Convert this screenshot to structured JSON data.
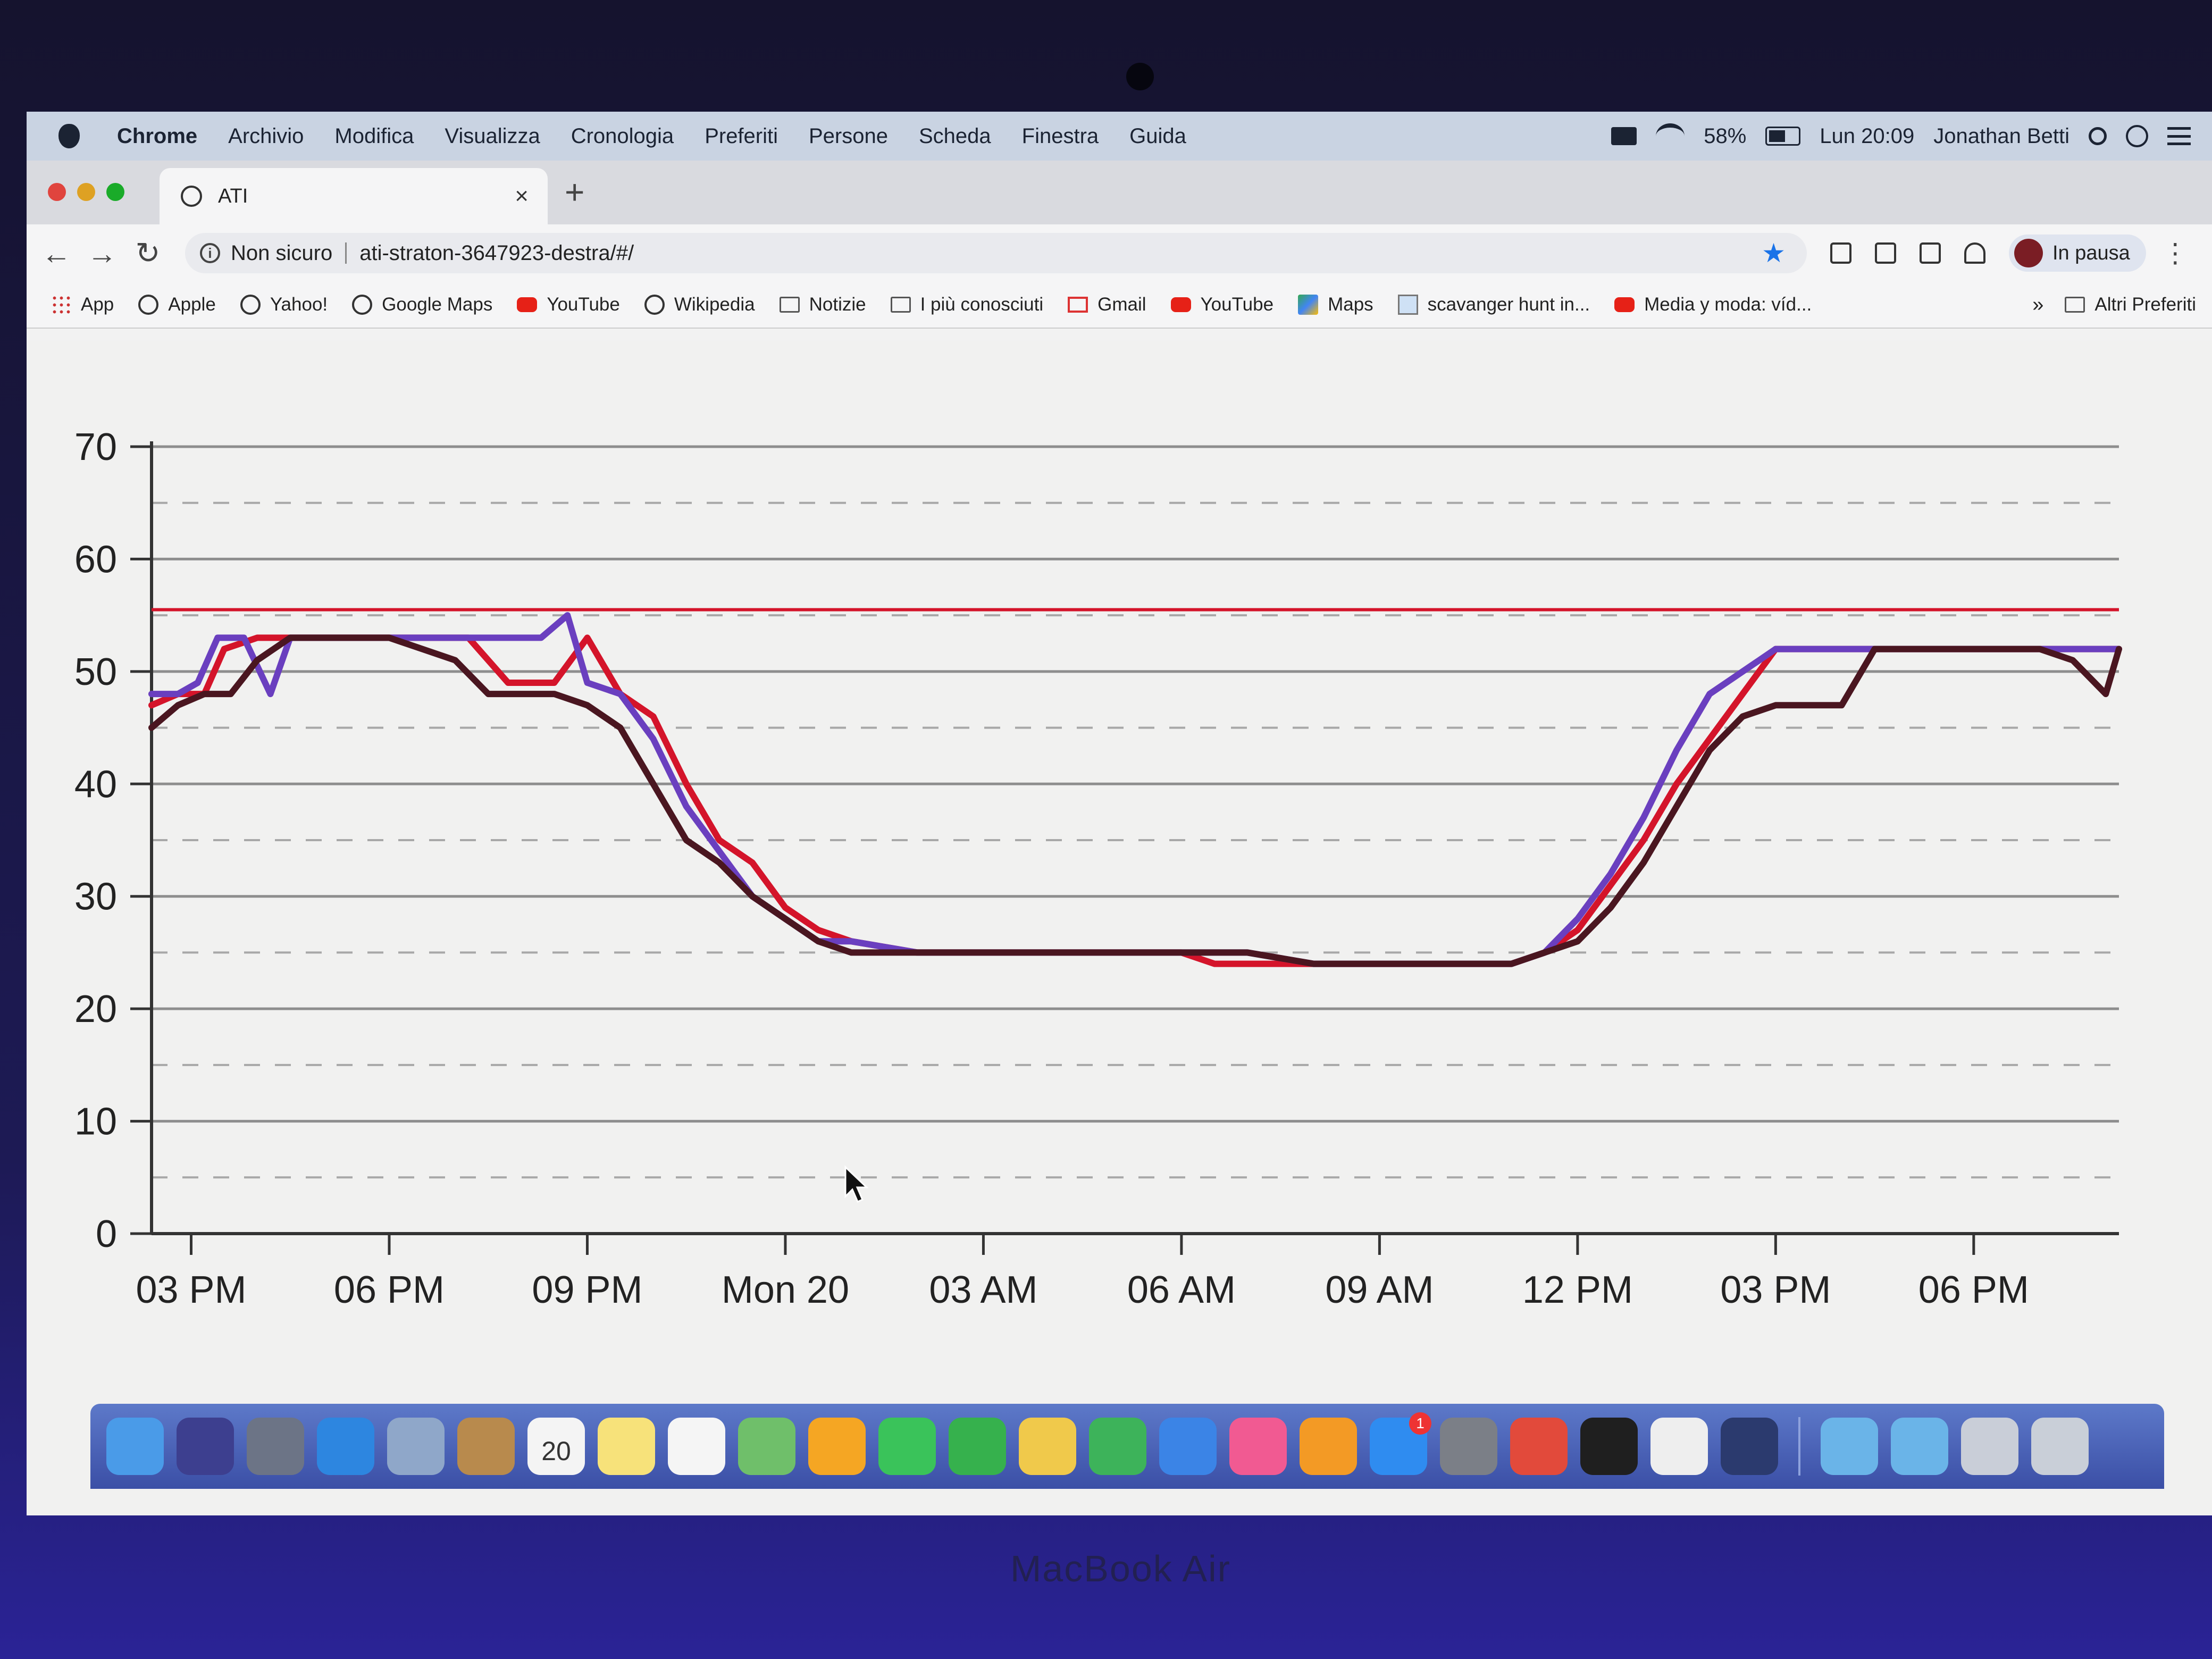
{
  "menubar": {
    "app_name": "Chrome",
    "items": [
      "Archivio",
      "Modifica",
      "Visualizza",
      "Cronologia",
      "Preferiti",
      "Persone",
      "Scheda",
      "Finestra",
      "Guida"
    ],
    "battery": "58%",
    "clock": "Lun 20:09",
    "user": "Jonathan Betti"
  },
  "tab": {
    "title": "ATI",
    "close": "×",
    "new_tab": "+"
  },
  "toolbar": {
    "security_label": "Non sicuro",
    "url": "ati-straton-3647923-destra/#/",
    "profile_label": "In pausa"
  },
  "bookmarks": {
    "items": [
      {
        "label": "App",
        "icon": "apps-grid-icon"
      },
      {
        "label": "Apple",
        "icon": "globe-icon"
      },
      {
        "label": "Yahoo!",
        "icon": "globe-icon"
      },
      {
        "label": "Google Maps",
        "icon": "globe-icon"
      },
      {
        "label": "YouTube",
        "icon": "youtube-icon"
      },
      {
        "label": "Wikipedia",
        "icon": "globe-icon"
      },
      {
        "label": "Notizie",
        "icon": "folder-icon"
      },
      {
        "label": "I più conosciuti",
        "icon": "folder-icon"
      },
      {
        "label": "Gmail",
        "icon": "gmail-icon"
      },
      {
        "label": "YouTube",
        "icon": "youtube-icon"
      },
      {
        "label": "Maps",
        "icon": "maps-icon"
      },
      {
        "label": "scavanger hunt in...",
        "icon": "document-icon"
      },
      {
        "label": "Media y moda: víd...",
        "icon": "youtube-icon"
      }
    ],
    "more": "»",
    "other": "Altri Preferiti"
  },
  "chart_data": {
    "type": "line",
    "ylim": [
      0,
      70
    ],
    "y_ticks": [
      "0",
      "10",
      "20",
      "30",
      "40",
      "50",
      "60",
      "70"
    ],
    "x_ticks": [
      "03 PM",
      "06 PM",
      "09 PM",
      "Mon 20",
      "03 AM",
      "06 AM",
      "09 AM",
      "12 PM",
      "03 PM",
      "06 PM"
    ],
    "x_tick_hours": [
      15,
      18,
      21,
      24,
      27,
      30,
      33,
      36,
      39,
      42
    ],
    "xlim_hours": [
      14.4,
      44.2
    ],
    "grid": true,
    "threshold": {
      "value": 55.5,
      "color": "#d4142a"
    },
    "series": [
      {
        "color": "#d4142a",
        "x": [
          14.4,
          14.8,
          15.2,
          15.5,
          16,
          16.5,
          17,
          17.5,
          18,
          18.5,
          19.2,
          19.8,
          20.5,
          21,
          21.5,
          22,
          22.5,
          23,
          23.5,
          24,
          24.5,
          25,
          26,
          28,
          30,
          30.5,
          31,
          32,
          33,
          34,
          35,
          35.5,
          36,
          36.5,
          37,
          37.5,
          38,
          38.5,
          39,
          39.5,
          40,
          41,
          42,
          43,
          44,
          44.2
        ],
        "y": [
          47,
          48,
          48,
          52,
          53,
          53,
          53,
          53,
          53,
          53,
          53,
          49,
          49,
          53,
          48,
          46,
          40,
          35,
          33,
          29,
          27,
          26,
          25,
          25,
          25,
          24,
          24,
          24,
          24,
          24,
          24,
          25,
          27,
          31,
          35,
          40,
          44,
          48,
          52,
          52,
          52,
          52,
          52,
          52,
          52,
          52
        ]
      },
      {
        "color": "#6a3fbf",
        "x": [
          14.4,
          14.8,
          15.1,
          15.4,
          15.8,
          16.2,
          16.5,
          17,
          17.5,
          18,
          18.5,
          19.2,
          19.8,
          20.3,
          20.7,
          21,
          21.5,
          22,
          22.5,
          23,
          23.5,
          24,
          24.5,
          25,
          26,
          28,
          30,
          31,
          32,
          33,
          34,
          35,
          35.5,
          36,
          36.5,
          37,
          37.5,
          38,
          38.5,
          39,
          39.5,
          40,
          41,
          42,
          43,
          44,
          44.2
        ],
        "y": [
          48,
          48,
          49,
          53,
          53,
          48,
          53,
          53,
          53,
          53,
          53,
          53,
          53,
          53,
          55,
          49,
          48,
          44,
          38,
          34,
          30,
          28,
          26,
          26,
          25,
          25,
          25,
          25,
          24,
          24,
          24,
          24,
          25,
          28,
          32,
          37,
          43,
          48,
          50,
          52,
          52,
          52,
          52,
          52,
          52,
          52,
          52
        ]
      },
      {
        "color": "#4a1620",
        "x": [
          14.4,
          14.8,
          15.2,
          15.6,
          16,
          16.5,
          17,
          17.5,
          18,
          18.5,
          19,
          19.5,
          20,
          20.5,
          21,
          21.5,
          22,
          22.5,
          23,
          23.5,
          24,
          24.5,
          25,
          26,
          28,
          30,
          31,
          32,
          33,
          34,
          35,
          35.5,
          36,
          36.5,
          37,
          37.5,
          38,
          38.5,
          39,
          39.5,
          40,
          40.5,
          41,
          42,
          43,
          43.5,
          44,
          44.2
        ],
        "y": [
          45,
          47,
          48,
          48,
          51,
          53,
          53,
          53,
          53,
          52,
          51,
          48,
          48,
          48,
          47,
          45,
          40,
          35,
          33,
          30,
          28,
          26,
          25,
          25,
          25,
          25,
          25,
          24,
          24,
          24,
          24,
          25,
          26,
          29,
          33,
          38,
          43,
          46,
          47,
          47,
          47,
          52,
          52,
          52,
          52,
          51,
          48,
          52
        ]
      }
    ]
  },
  "dock": {
    "apps": [
      {
        "name": "finder-icon",
        "color": "#4a9be8"
      },
      {
        "name": "siri-icon",
        "color": "#3d3f8f"
      },
      {
        "name": "launchpad-icon",
        "color": "#6c7486"
      },
      {
        "name": "safari-icon",
        "color": "#2d86e0"
      },
      {
        "name": "preview-icon",
        "color": "#8fa7c9"
      },
      {
        "name": "contacts-icon",
        "color": "#b88a4d"
      },
      {
        "name": "calendar-icon",
        "color": "#f4f4f4",
        "text": "20"
      },
      {
        "name": "notes-icon",
        "color": "#f7e27a"
      },
      {
        "name": "reminders-icon",
        "color": "#f5f5f5"
      },
      {
        "name": "maps-icon",
        "color": "#6fbf6a"
      },
      {
        "name": "photos-icon",
        "color": "#f5a623"
      },
      {
        "name": "messages-icon",
        "color": "#3ac35a"
      },
      {
        "name": "facetime-icon",
        "color": "#36b14d"
      },
      {
        "name": "slides-icon",
        "color": "#f0c94b"
      },
      {
        "name": "numbers-icon",
        "color": "#3db35a"
      },
      {
        "name": "keynote-icon",
        "color": "#3b84e6"
      },
      {
        "name": "itunes-icon",
        "color": "#f15a92"
      },
      {
        "name": "books-icon",
        "color": "#f39a25"
      },
      {
        "name": "app-store-icon",
        "color": "#2f8cf0",
        "badge": "1"
      },
      {
        "name": "system-preferences-icon",
        "color": "#7b7f87"
      },
      {
        "name": "chrome-icon",
        "color": "#e24a3b"
      },
      {
        "name": "terminal-icon",
        "color": "#1f1f1f"
      },
      {
        "name": "textedit-icon",
        "color": "#eeeeee"
      },
      {
        "name": "quicktime-icon",
        "color": "#2b3a6e"
      }
    ],
    "stacks": [
      {
        "name": "downloads-folder-icon",
        "color": "#6ab4e8"
      },
      {
        "name": "applications-folder-icon",
        "color": "#6ab4e8"
      },
      {
        "name": "screenshot-stack-icon",
        "color": "#c9ced8"
      },
      {
        "name": "trash-icon",
        "color": "#c9cfd8"
      }
    ]
  },
  "bottom_label": "MacBook Air"
}
